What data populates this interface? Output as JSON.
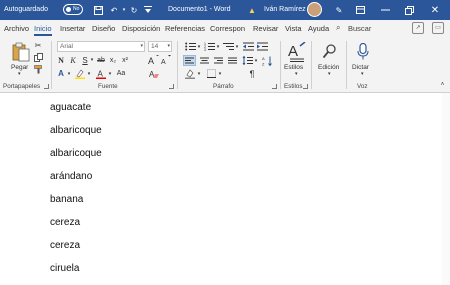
{
  "titlebar": {
    "autosave_label": "Autoguardado",
    "toggle_state": "No",
    "document_title": "Documento1 - Word",
    "user_name": "Iván Ramírez"
  },
  "tabs": [
    {
      "label": "Archivo"
    },
    {
      "label": "Inicio"
    },
    {
      "label": "Insertar"
    },
    {
      "label": "Diseño"
    },
    {
      "label": "Disposición"
    },
    {
      "label": "Referencias"
    },
    {
      "label": "Correspon"
    },
    {
      "label": "Revisar"
    },
    {
      "label": "Vista"
    },
    {
      "label": "Ayuda"
    }
  ],
  "search_label": "Buscar",
  "ribbon": {
    "clipboard": {
      "paste_label": "Pegar",
      "group_label": "Portapapeles"
    },
    "font": {
      "font_name": "Arial",
      "font_size": "14",
      "group_label": "Fuente"
    },
    "paragraph": {
      "group_label": "Párrafo"
    },
    "styles": {
      "styles_label": "Estilos",
      "group_label": "Estilos"
    },
    "editing": {
      "editing_label": "Edición"
    },
    "voice": {
      "dictate_label": "Dictar",
      "group_label": "Voz"
    }
  },
  "document": {
    "items": [
      "aguacate",
      "albaricoque",
      "albaricoque",
      "arándano",
      "banana",
      "cereza",
      "cereza",
      "ciruela"
    ]
  },
  "colors": {
    "accent": "#2b579a",
    "ribbon_bg": "#f3f3f3"
  }
}
